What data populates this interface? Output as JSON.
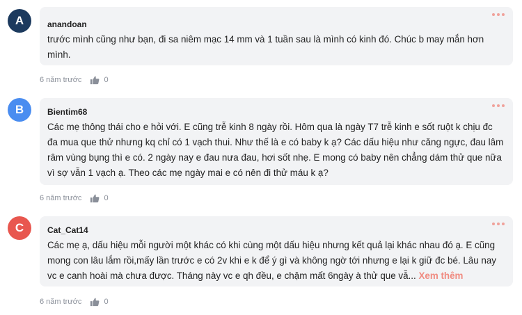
{
  "comments": [
    {
      "avatar_letter": "A",
      "avatar_color": "#1c3a5e",
      "username": "anandoan",
      "text": "trước mình cũng như bạn, đi sa niêm mạc 14 mm và 1 tuần sau là mình có kinh đó. Chúc b may mắn hơn mình.",
      "time": "6 năm trước",
      "likes": "0"
    },
    {
      "avatar_letter": "B",
      "avatar_color": "#4a8df0",
      "username": "Bientim68",
      "text": "Các mẹ thông thái cho e hỏi với. E cũng trễ kinh 8 ngày rồi. Hôm qua là ngày T7 trễ kinh e sốt ruột k chịu đc đa mua que thử nhưng kq chỉ có 1 vạch thui. Như thế là e có baby k ạ? Các dấu hiệu như căng ngực, đau lâm râm vùng bụng thì e có. 2 ngày nay e đau nưa đau, hơi sốt nhẹ. E mong có baby nên chẳng dám thử que nữa vì sợ vẫn 1 vạch ạ. Theo các mẹ ngày mai e có nên đi thử máu k ạ?",
      "time": "6 năm trước",
      "likes": "0"
    },
    {
      "avatar_letter": "C",
      "avatar_color": "#e8574f",
      "username": "Cat_Cat14",
      "text": "Các mẹ ạ, dấu hiệu mỗi người một khác có khi cùng một dấu hiệu nhưng kết quả lại khác nhau đó ạ. E cũng mong con lâu lắm rồi,mấy lần trước e có 2v khi e k để ý gì và không ngờ tới nhưng e lại k giữ đc bé. Lâu nay vc e canh hoài mà chưa được. Tháng này vc e qh đều, e chậm mất 6ngày à thử que vẫ...",
      "see_more": "Xem thêm",
      "time": "6 năm trước",
      "likes": "0"
    }
  ]
}
